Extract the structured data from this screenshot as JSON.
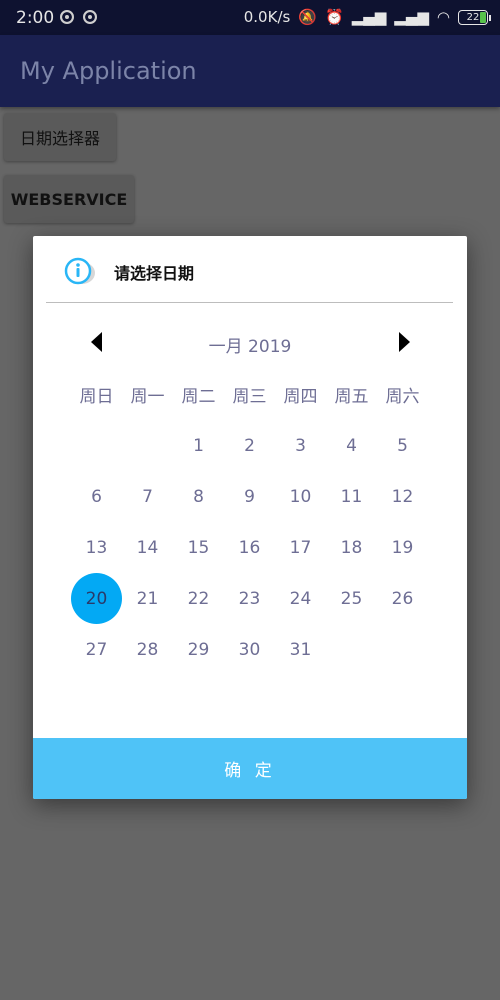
{
  "statusbar": {
    "time": "2:00",
    "network_speed": "0.0K/s",
    "battery": "22"
  },
  "app": {
    "title": "My Application",
    "buttons": [
      "日期选择器",
      "WEBSERVICE"
    ]
  },
  "dialog": {
    "title": "请选择日期",
    "month_label": "一月 2019",
    "weekdays": [
      "周日",
      "周一",
      "周二",
      "周三",
      "周四",
      "周五",
      "周六"
    ],
    "weeks": [
      [
        "",
        "",
        "1",
        "2",
        "3",
        "4",
        "5"
      ],
      [
        "6",
        "7",
        "8",
        "9",
        "10",
        "11",
        "12"
      ],
      [
        "13",
        "14",
        "15",
        "16",
        "17",
        "18",
        "19"
      ],
      [
        "20",
        "21",
        "22",
        "23",
        "24",
        "25",
        "26"
      ],
      [
        "27",
        "28",
        "29",
        "30",
        "31",
        "",
        ""
      ]
    ],
    "selected_day": "20",
    "confirm_label": "确 定"
  },
  "colors": {
    "selected": "#03a9f4",
    "confirm": "#4fc3f7",
    "day_text": "#6e6e94"
  }
}
